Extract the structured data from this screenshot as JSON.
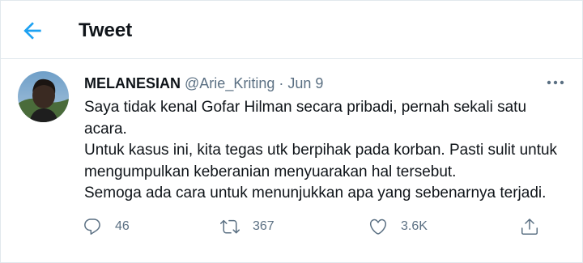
{
  "header": {
    "title": "Tweet",
    "back_icon": "arrow-left-icon"
  },
  "tweet": {
    "author_name": "MELANESIAN",
    "handle": "@Arie_Kriting",
    "separator": "·",
    "date": "Jun 9",
    "lines": [
      "Saya tidak kenal Gofar Hilman secara pribadi, pernah sekali satu acara.",
      "Untuk kasus ini, kita tegas utk berpihak pada korban. Pasti sulit untuk mengumpulkan keberanian menyuarakan hal tersebut.",
      "Semoga ada cara untuk menunjukkan apa yang sebenarnya terjadi."
    ]
  },
  "actions": {
    "replies": "46",
    "retweets": "367",
    "likes": "3.6K"
  },
  "colors": {
    "accent": "#1da1f2",
    "muted": "#5b7083",
    "text": "#0f1419",
    "border": "#e1e8ed"
  }
}
